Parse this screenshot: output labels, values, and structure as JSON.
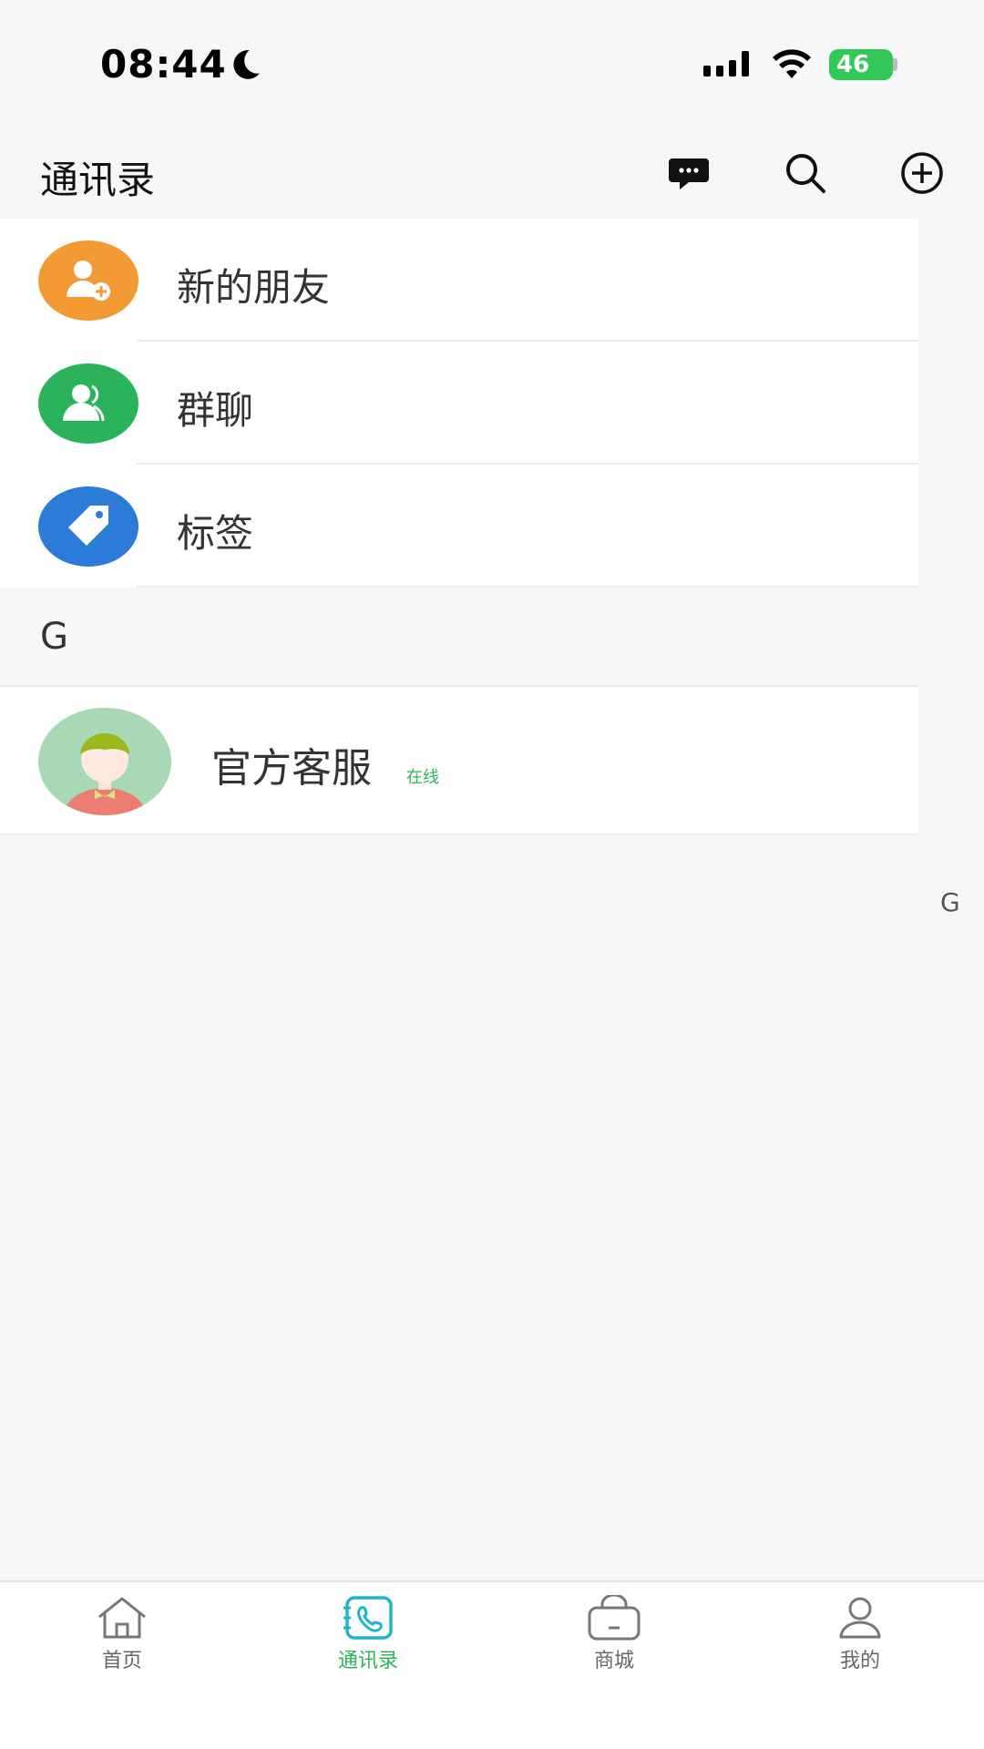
{
  "status_bar": {
    "time": "08:44",
    "battery": "46"
  },
  "header": {
    "title": "通讯录",
    "icons": [
      "message-icon",
      "search-icon",
      "add-circle-icon"
    ]
  },
  "menu": {
    "items": [
      {
        "label": "新的朋友",
        "icon": "add-friend-icon",
        "color": "#f39a35"
      },
      {
        "label": "群聊",
        "icon": "group-chat-icon",
        "color": "#2bb35b"
      },
      {
        "label": "标签",
        "icon": "tag-icon",
        "color": "#2d7bd8"
      }
    ]
  },
  "contacts": {
    "section_letter": "G",
    "items": [
      {
        "name": "官方客服",
        "status": "在线"
      }
    ]
  },
  "index_bar": {
    "letters": [
      "G"
    ]
  },
  "tab_bar": {
    "tabs": [
      {
        "label": "首页",
        "icon": "home-icon",
        "active": false
      },
      {
        "label": "通讯录",
        "icon": "contacts-icon",
        "active": true
      },
      {
        "label": "商城",
        "icon": "shop-bag-icon",
        "active": false
      },
      {
        "label": "我的",
        "icon": "profile-icon",
        "active": false
      }
    ],
    "active_color": "#2bb35b"
  }
}
